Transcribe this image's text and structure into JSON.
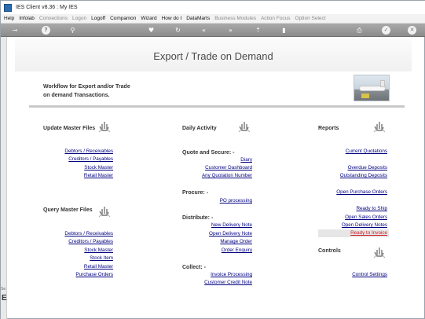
{
  "window": {
    "title": "IES Client v8.36 : My IES"
  },
  "menu": [
    {
      "label": "Help",
      "enabled": true
    },
    {
      "label": "Infolab",
      "enabled": true
    },
    {
      "label": "Connections",
      "enabled": false
    },
    {
      "label": "Logon",
      "enabled": false
    },
    {
      "label": "Logoff",
      "enabled": true
    },
    {
      "label": "Companion",
      "enabled": true
    },
    {
      "label": "Wizard",
      "enabled": true
    },
    {
      "label": "How do I",
      "enabled": true
    },
    {
      "label": "DataMarts",
      "enabled": true
    },
    {
      "label": "Business Modules",
      "enabled": false
    },
    {
      "label": "Action Focus",
      "enabled": false
    },
    {
      "label": "Option Select",
      "enabled": false
    }
  ],
  "toolbar": {
    "icons": [
      "key-icon",
      "help-icon",
      "search-icon",
      "favorite-icon",
      "refresh-icon",
      "back-icon",
      "forward-icon",
      "bookmark-icon",
      "stop-icon",
      "print-icon",
      "ok-icon",
      "close-icon"
    ]
  },
  "leftstrip": {
    "label1": "Se",
    "label2": "E"
  },
  "page": {
    "title": "Export / Trade on Demand",
    "intro_line1": "Workflow for Export and/or Trade",
    "intro_line2": "on demand Transactions."
  },
  "col1": {
    "update_title": "Update Master Files",
    "update_links": [
      "Debtors / Receivables",
      "Creditors / Payables",
      "Stock Master",
      "Retail Master"
    ],
    "query_title": "Query Master Files",
    "query_links": [
      "Debtors / Receivables",
      "Creditors / Payables",
      "Stock Master",
      "Stock Item",
      "Retail Master",
      "Purchase Orders"
    ]
  },
  "col2": {
    "title": "Daily Activity",
    "quote_title": "Quote and Secure: -",
    "quote_links": [
      "Diary",
      "Customer Dashboard",
      "Any Quotation Number"
    ],
    "procure_title": "Procure: -",
    "procure_links": [
      "PO processing"
    ],
    "distribute_title": "Distribute: -",
    "distribute_links": [
      "New Delivery Note",
      "Open Delivery Note",
      "Manage Order",
      "Order Enquiry"
    ],
    "collect_title": "Collect: -",
    "collect_links": [
      "Invoice Processing",
      "Customer Credit Note"
    ]
  },
  "col3": {
    "reports_title": "Reports",
    "report_links": [
      "Current Quotations",
      "Overdue Deposits",
      "Outstanding Deposits",
      "Open Purchase Orders",
      "Ready to Ship",
      "Open Sales Orders",
      "Open Delivery Notes",
      "Ready to Invoice"
    ],
    "controls_title": "Controls",
    "control_links": [
      "Control Settings"
    ]
  },
  "colors": {
    "link": "#000080",
    "highlight_link": "#d0202a",
    "toolbar": "#9a9a9a"
  }
}
